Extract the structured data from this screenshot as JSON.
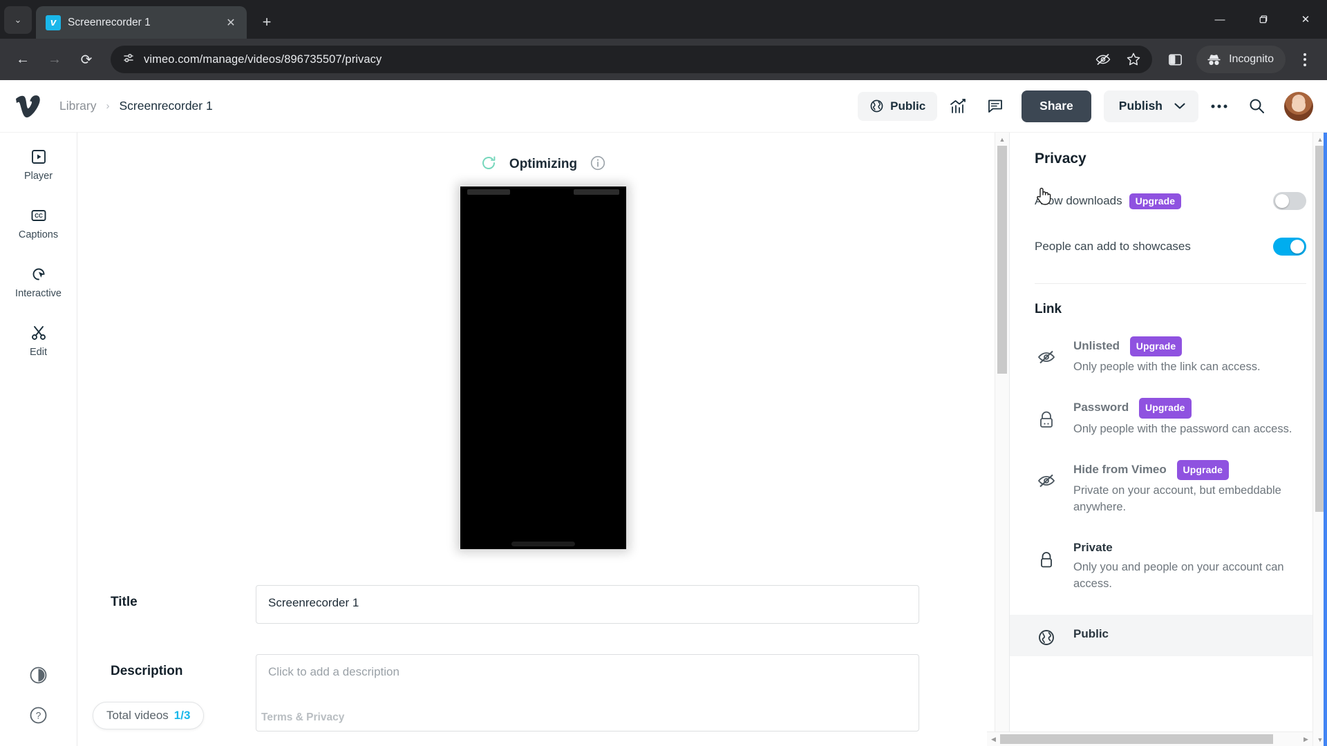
{
  "browser": {
    "tab": {
      "title": "Screenrecorder 1",
      "favicon_letter": "v",
      "close_label": "✕"
    },
    "new_tab_label": "+",
    "tab_search_label": "⌄",
    "window_controls": {
      "minimize": "—",
      "maximize": "❐",
      "close": "✕"
    },
    "nav": {
      "back": "←",
      "forward": "→",
      "reload": "⟳"
    },
    "url": "vimeo.com/manage/videos/896735507/privacy",
    "profile_label": "Incognito"
  },
  "header": {
    "breadcrumb": {
      "library": "Library",
      "separator": "›",
      "current": "Screenrecorder 1"
    },
    "privacy_pill": "Public",
    "share_label": "Share",
    "publish_label": "Publish",
    "chevron": "⌄"
  },
  "rail": {
    "items": [
      {
        "label": "Player",
        "icon": "player-icon"
      },
      {
        "label": "Captions",
        "icon": "captions-icon"
      },
      {
        "label": "Interactive",
        "icon": "interactive-icon"
      },
      {
        "label": "Edit",
        "icon": "edit-scissors-icon"
      }
    ]
  },
  "main": {
    "status": "Optimizing",
    "form": {
      "title_label": "Title",
      "title_value": "Screenrecorder 1",
      "description_label": "Description",
      "description_placeholder": "Click to add a description"
    },
    "total_videos_label": "Total videos",
    "total_videos_count": "1/3",
    "terms_label": "Terms & Privacy"
  },
  "privacy_panel": {
    "title": "Privacy",
    "toggles": [
      {
        "label": "Allow downloads",
        "badge": "Upgrade",
        "state": "off"
      },
      {
        "label": "People can add to showcases",
        "badge": "",
        "state": "on"
      }
    ],
    "link_section_title": "Link",
    "options": [
      {
        "name": "Unlisted",
        "badge": "Upgrade",
        "description": "Only people with the link can access.",
        "icon": "eye-slash-icon",
        "selected": false,
        "muted": true
      },
      {
        "name": "Password",
        "badge": "Upgrade",
        "description": "Only people with the password can access.",
        "icon": "lock-password-icon",
        "selected": false,
        "muted": true
      },
      {
        "name": "Hide from Vimeo",
        "badge": "Upgrade",
        "description": "Private on your account, but embeddable anywhere.",
        "icon": "eye-slash-icon",
        "selected": false,
        "muted": true
      },
      {
        "name": "Private",
        "badge": "",
        "description": "Only you and people on your account can access.",
        "icon": "lock-icon",
        "selected": false,
        "muted": false
      },
      {
        "name": "Public",
        "badge": "",
        "description": "",
        "icon": "globe-icon",
        "selected": true,
        "muted": false
      }
    ]
  },
  "colors": {
    "accent_blue": "#00adef",
    "upgrade_purple": "#8f52e0",
    "share_button": "#3c4753",
    "browser_chrome": "#202124"
  }
}
